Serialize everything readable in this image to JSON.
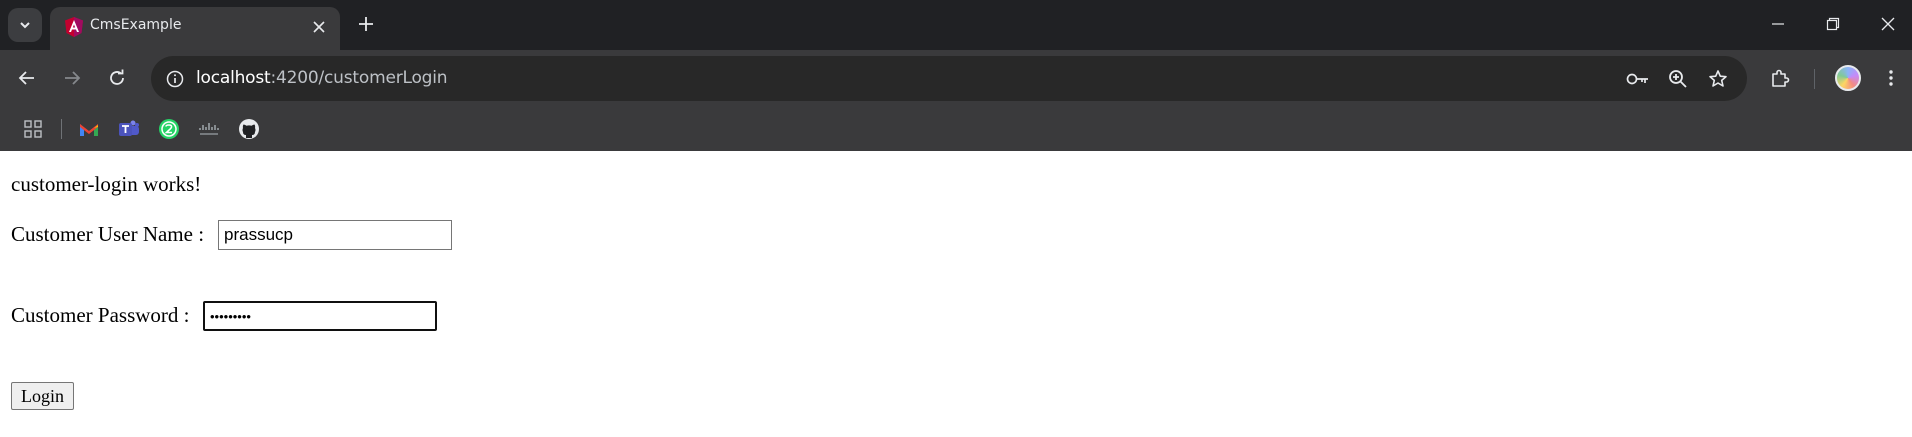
{
  "browser": {
    "tab": {
      "title": "CmsExample"
    },
    "address_bar": {
      "host": "localhost",
      "path": ":4200/customerLogin"
    }
  },
  "page": {
    "heading": "customer-login works!",
    "username": {
      "label": "Customer User Name :",
      "value": "prassucp"
    },
    "password": {
      "label": "Customer Password :",
      "value": "•••••••••"
    },
    "login_button": "Login"
  },
  "colors": {
    "tab_strip": "#202124",
    "toolbar": "#3a3a3c",
    "omnibox": "#282828",
    "page_background": "#ffffff"
  },
  "icons": {
    "tab_search": "chevron-down-icon",
    "favicon": "angular-icon",
    "bookmarks": [
      "apps-grid-icon",
      "gmail-icon",
      "teams-icon",
      "whatsapp-icon",
      "cisco-icon",
      "github-icon"
    ]
  }
}
